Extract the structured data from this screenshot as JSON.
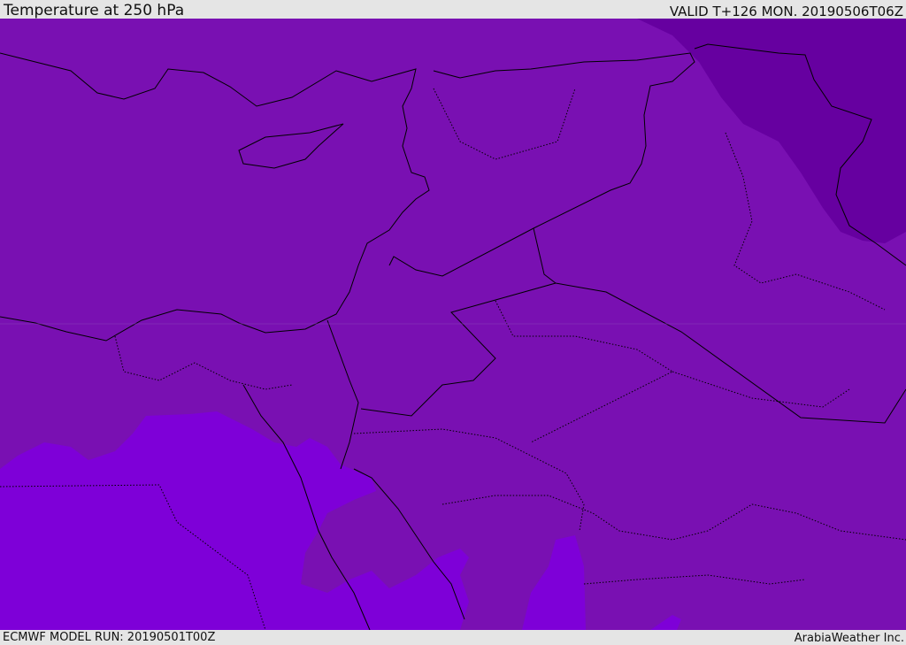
{
  "header": {
    "title": "Temperature at 250 hPa",
    "valid": "VALID T+126 MON. 20190506T06Z"
  },
  "footer": {
    "model_run": "ECMWF MODEL RUN: 20190501T00Z",
    "brand": "ArabiaWeather Inc."
  },
  "colors": {
    "base": "#7910b2",
    "cold": "#6600a0",
    "warm": "#7e00d8",
    "border": "#000000"
  }
}
